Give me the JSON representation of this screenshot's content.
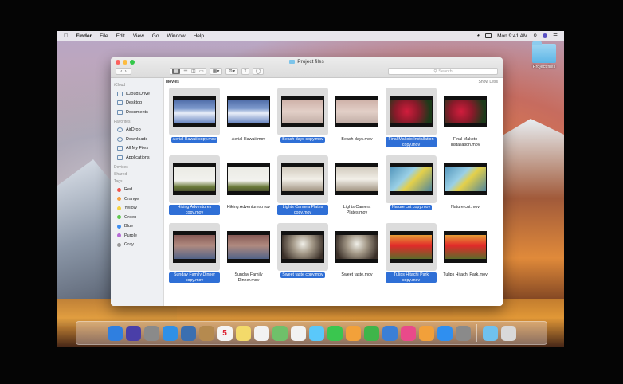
{
  "menubar": {
    "app": "Finder",
    "items": [
      "File",
      "Edit",
      "View",
      "Go",
      "Window",
      "Help"
    ],
    "clock": "Mon 9:41 AM"
  },
  "desktop": {
    "folder_label": "Project files"
  },
  "window": {
    "title": "Project files",
    "search_placeholder": "Search",
    "section_label": "Movies",
    "show_less": "Show Less"
  },
  "sidebar": {
    "sections": [
      {
        "header": "iCloud",
        "items": [
          {
            "label": "iCloud Drive",
            "icon": "cloud-icon"
          },
          {
            "label": "Desktop",
            "icon": "desktop-icon"
          },
          {
            "label": "Documents",
            "icon": "documents-icon"
          }
        ]
      },
      {
        "header": "Favorites",
        "items": [
          {
            "label": "AirDrop",
            "icon": "airdrop-icon"
          },
          {
            "label": "Downloads",
            "icon": "downloads-icon"
          },
          {
            "label": "All My Files",
            "icon": "all-files-icon"
          },
          {
            "label": "Applications",
            "icon": "applications-icon"
          }
        ]
      },
      {
        "header": "Devices",
        "items": []
      },
      {
        "header": "Shared",
        "items": []
      }
    ],
    "tags_header": "Tags",
    "tags": [
      {
        "label": "Red",
        "color": "#f2544c"
      },
      {
        "label": "Orange",
        "color": "#f6a140"
      },
      {
        "label": "Yellow",
        "color": "#f5d33f"
      },
      {
        "label": "Green",
        "color": "#5fc84f"
      },
      {
        "label": "Blue",
        "color": "#3d8ef0"
      },
      {
        "label": "Purple",
        "color": "#b66ad6"
      },
      {
        "label": "Gray",
        "color": "#9a9a9a"
      }
    ]
  },
  "files": [
    {
      "name": "Aerial Hawaii copy.mov",
      "selected": true,
      "thumb": "t-hawaii"
    },
    {
      "name": "Aerial Hawaii.mov",
      "selected": false,
      "thumb": "t-hawaii"
    },
    {
      "name": "Beach days copy.mov",
      "selected": true,
      "thumb": "t-beach"
    },
    {
      "name": "Beach days.mov",
      "selected": false,
      "thumb": "t-beach"
    },
    {
      "name": "Final Makoto Installation copy.mov",
      "selected": true,
      "thumb": "t-makoto"
    },
    {
      "name": "Final Makoto Installation.mov",
      "selected": false,
      "thumb": "t-makoto"
    },
    {
      "name": "Hiking Adventures copy.mov",
      "selected": true,
      "thumb": "t-hiking"
    },
    {
      "name": "Hiking Adventures.mov",
      "selected": false,
      "thumb": "t-hiking"
    },
    {
      "name": "Lights Camera Plates copy.mov",
      "selected": true,
      "thumb": "t-lights"
    },
    {
      "name": "Lights Camera Plates.mov",
      "selected": false,
      "thumb": "t-lights"
    },
    {
      "name": "Nature cut copy.mov",
      "selected": true,
      "thumb": "t-nature"
    },
    {
      "name": "Nature cut.mov",
      "selected": false,
      "thumb": "t-nature"
    },
    {
      "name": "Sunday Family Dinner copy.mov",
      "selected": true,
      "thumb": "t-sunday"
    },
    {
      "name": "Sunday Family Dinner.mov",
      "selected": false,
      "thumb": "t-sunday"
    },
    {
      "name": "Sweet taste copy.mov",
      "selected": true,
      "thumb": "t-sweet"
    },
    {
      "name": "Sweet taste.mov",
      "selected": false,
      "thumb": "t-sweet"
    },
    {
      "name": "Tulips Hitachi Park copy.mov",
      "selected": true,
      "thumb": "t-tulips"
    },
    {
      "name": "Tulips Hitachi Park.mov",
      "selected": false,
      "thumb": "t-tulips"
    }
  ],
  "dock": [
    {
      "name": "finder-icon",
      "bg": "#2f7fe0"
    },
    {
      "name": "siri-icon",
      "bg": "#4a3fa8"
    },
    {
      "name": "launchpad-icon",
      "bg": "#8a8a8a"
    },
    {
      "name": "safari-icon",
      "bg": "#2f90e6"
    },
    {
      "name": "photo-browser-icon",
      "bg": "#3b6fb0"
    },
    {
      "name": "notebook-icon",
      "bg": "#b58a4f"
    },
    {
      "name": "calendar-icon",
      "bg": "#f4f4f4",
      "text": "5"
    },
    {
      "name": "notes-icon",
      "bg": "#f3da6a"
    },
    {
      "name": "reminders-icon",
      "bg": "#f2f2f2"
    },
    {
      "name": "maps-icon",
      "bg": "#6fc06a"
    },
    {
      "name": "photos-icon",
      "bg": "#f2f2f2"
    },
    {
      "name": "messages-icon",
      "bg": "#5ac8fa"
    },
    {
      "name": "facetime-icon",
      "bg": "#3ac64f"
    },
    {
      "name": "pages-icon",
      "bg": "#f2a13a"
    },
    {
      "name": "numbers-icon",
      "bg": "#3fb54a"
    },
    {
      "name": "keynote-icon",
      "bg": "#3b7fd6"
    },
    {
      "name": "itunes-icon",
      "bg": "#e94a8a"
    },
    {
      "name": "ibooks-icon",
      "bg": "#f2a03a"
    },
    {
      "name": "app-store-icon",
      "bg": "#2f8ff0"
    },
    {
      "name": "system-preferences-icon",
      "bg": "#8a8a8a"
    },
    {
      "name": "downloads-folder-icon",
      "bg": "#6fc1ee",
      "after_sep": true
    },
    {
      "name": "trash-icon",
      "bg": "#d9d9d9"
    }
  ]
}
